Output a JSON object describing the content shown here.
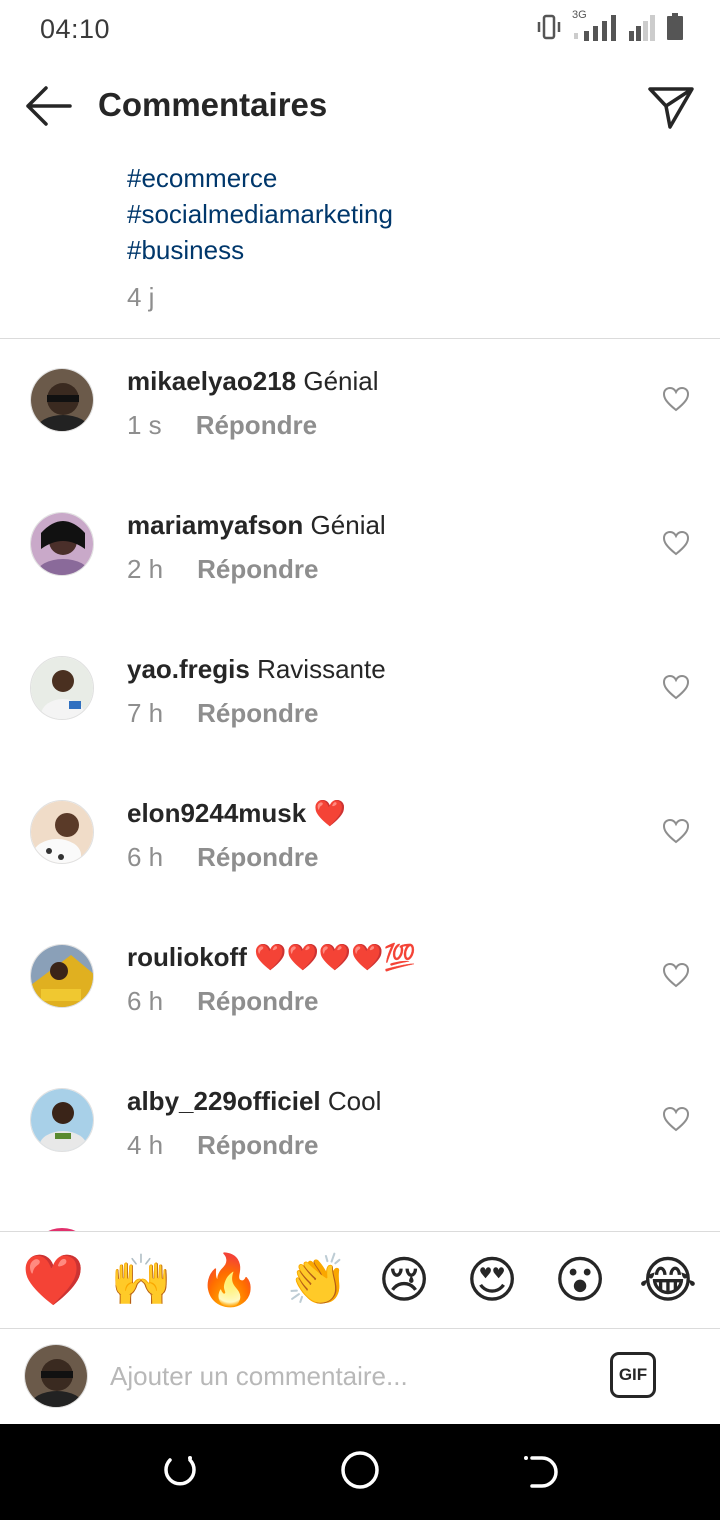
{
  "status_bar": {
    "time": "04:10",
    "network": "3G",
    "icons": [
      "vibrate-icon",
      "signal-icon",
      "signal-icon",
      "battery-icon"
    ]
  },
  "header": {
    "title": "Commentaires",
    "back_icon": "arrow-left-icon",
    "send_icon": "paper-plane-icon"
  },
  "caption": {
    "hashtags": [
      "#ecommerce",
      "#socialmediamarketing",
      "#business"
    ],
    "time": "4 j"
  },
  "comments": [
    {
      "username": "mikaelyao218",
      "text": "Génial",
      "time": "1 s",
      "reply_label": "Répondre"
    },
    {
      "username": "mariamyafson",
      "text": "Génial",
      "time": "2 h",
      "reply_label": "Répondre"
    },
    {
      "username": "yao.fregis",
      "text": "Ravissante",
      "time": "7 h",
      "reply_label": "Répondre"
    },
    {
      "username": "elon9244musk",
      "text": "❤️",
      "time": "6 h",
      "reply_label": "Répondre"
    },
    {
      "username": "rouliokoff",
      "text": "❤️❤️❤️❤️💯",
      "time": "6 h",
      "reply_label": "Répondre"
    },
    {
      "username": "alby_229officiel",
      "text": "Cool",
      "time": "4 h",
      "reply_label": "Répondre"
    }
  ],
  "emoji_bar": [
    "❤️",
    "🙌",
    "🔥",
    "👏",
    "😢",
    "😍",
    "😮",
    "😂"
  ],
  "input": {
    "placeholder": "Ajouter un commentaire...",
    "gif_label": "GIF"
  },
  "colors": {
    "hashtag": "#00376b",
    "secondary_text": "#8e8e8e",
    "divider": "#dbdbdb",
    "primary_text": "#262626"
  }
}
